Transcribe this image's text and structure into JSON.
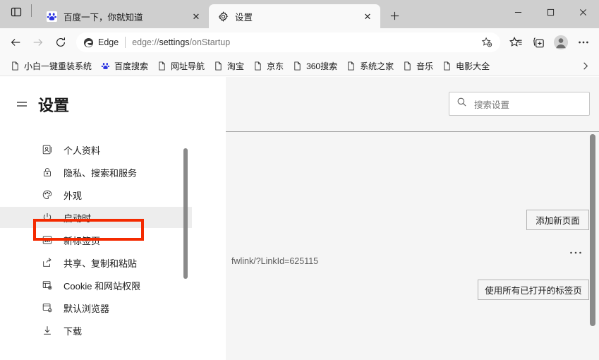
{
  "window": {
    "controls": [
      {
        "name": "minimize",
        "glyph": "—"
      },
      {
        "name": "maximize",
        "glyph": "☐"
      },
      {
        "name": "close",
        "glyph": "✕"
      }
    ]
  },
  "tabstrip": {
    "tab_actions_label": "",
    "tabs": [
      {
        "title": "百度一下，你就知道",
        "favicon": "baidu-paw-icon",
        "active": false,
        "close_glyph": "✕"
      },
      {
        "title": "设置",
        "favicon": "gear-icon",
        "active": true,
        "close_glyph": "✕"
      }
    ],
    "new_tab_glyph": "＋"
  },
  "toolbar": {
    "back_glyph": "←",
    "forward_glyph": "→",
    "refresh_glyph": "⟳",
    "edge_label": "Edge",
    "url_prefix": "edge://",
    "url_bold": "settings",
    "url_suffix": "/onStartup",
    "favorite_add": "favorite-add-icon",
    "favorites": "favorites-icon",
    "collections": "collections-icon",
    "profile": "profile-avatar-icon",
    "more": "⋯"
  },
  "bookmarks": {
    "items": [
      {
        "label": "小白一键重装系统",
        "icon": "page-icon"
      },
      {
        "label": "百度搜索",
        "icon": "baidu-paw-icon"
      },
      {
        "label": "网址导航",
        "icon": "page-icon"
      },
      {
        "label": "淘宝",
        "icon": "page-icon"
      },
      {
        "label": "京东",
        "icon": "page-icon"
      },
      {
        "label": "360搜索",
        "icon": "page-icon"
      },
      {
        "label": "系统之家",
        "icon": "page-icon"
      },
      {
        "label": "音乐",
        "icon": "page-icon"
      },
      {
        "label": "电影大全",
        "icon": "page-icon"
      }
    ],
    "overflow_glyph": "›"
  },
  "settings": {
    "title": "设置",
    "menu_icon": "hamburger-icon",
    "search": {
      "placeholder": "搜索设置",
      "icon": "search-icon"
    },
    "nav": [
      {
        "label": "个人资料",
        "icon": "profile-card-icon",
        "selected": false
      },
      {
        "label": "隐私、搜索和服务",
        "icon": "lock-icon",
        "selected": false
      },
      {
        "label": "外观",
        "icon": "palette-icon",
        "selected": false
      },
      {
        "label": "启动时",
        "icon": "power-icon",
        "selected": true
      },
      {
        "label": "新标签页",
        "icon": "newtab-icon",
        "selected": false
      },
      {
        "label": "共享、复制和粘贴",
        "icon": "share-icon",
        "selected": false
      },
      {
        "label": "Cookie 和网站权限",
        "icon": "cookie-icon",
        "selected": false
      },
      {
        "label": "默认浏览器",
        "icon": "default-browser-icon",
        "selected": false
      },
      {
        "label": "下载",
        "icon": "download-icon",
        "selected": false
      }
    ]
  },
  "content": {
    "clipped_url_text": "fwlink/?LinkId=625115",
    "add_page_button": "添加新页面",
    "use_open_tabs_button": "使用所有已打开的标签页",
    "row_more_glyph": "⋯"
  },
  "annotation": {
    "highlight_color": "#f42a00",
    "highlight_target": "启动时"
  }
}
